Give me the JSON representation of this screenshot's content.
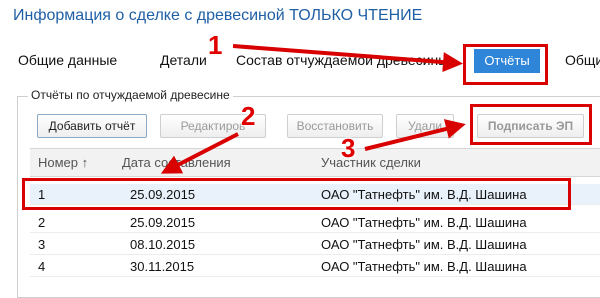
{
  "window": {
    "title": "Информация о сделке с древесиной ТОЛЬКО ЧТЕНИЕ"
  },
  "tabs": [
    {
      "label": "Общие данные"
    },
    {
      "label": "Детали"
    },
    {
      "label": "Состав отчуждаемой древесины"
    },
    {
      "label": "Отчёты"
    },
    {
      "label": "Общи"
    }
  ],
  "section": {
    "legend": "Отчёты по отчуждаемой древесине"
  },
  "toolbar": {
    "add": "Добавить отчёт",
    "edit": "Редактиров",
    "restore": "Восстановить",
    "delete": "Удали",
    "sign": "Подписать ЭП"
  },
  "table": {
    "columns": [
      "Номер",
      "Дата составления",
      "Участник сделки"
    ],
    "sort_icon": "↑",
    "rows": [
      {
        "num": "1",
        "date": "25.09.2015",
        "party": "ОАО \"Татнефть\" им. В.Д. Шашина"
      },
      {
        "num": "2",
        "date": "25.09.2015",
        "party": "ОАО \"Татнефть\" им. В.Д. Шашина"
      },
      {
        "num": "3",
        "date": "08.10.2015",
        "party": "ОАО \"Татнефть\" им. В.Д. Шашина"
      },
      {
        "num": "4",
        "date": "30.11.2015",
        "party": "ОАО \"Татнефть\" им. В.Д. Шашина"
      }
    ]
  },
  "annotations": {
    "step1": "1",
    "step2": "2",
    "step3": "3"
  },
  "colors": {
    "accent": "#2f86d8",
    "highlight": "#d90000",
    "title": "#1f5fa6"
  }
}
